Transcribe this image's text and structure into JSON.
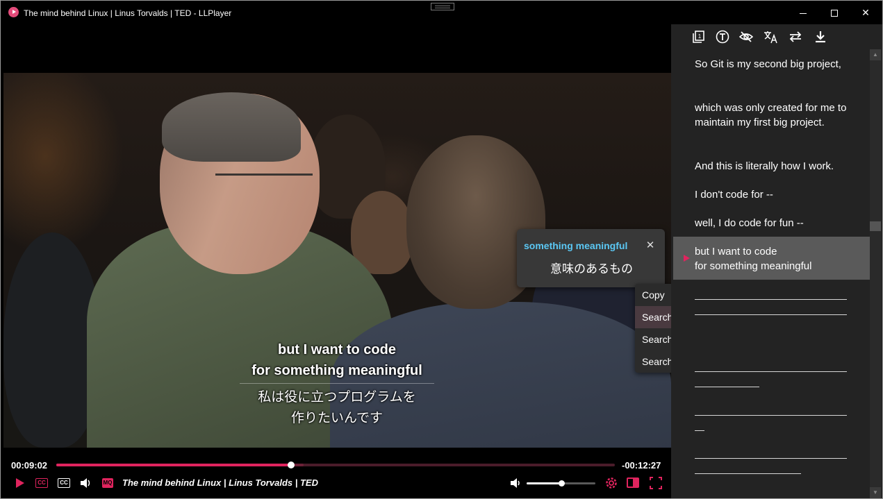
{
  "window": {
    "title": "The mind behind Linux | Linus Torvalds | TED - LLPlayer",
    "minimize_glyph": "─",
    "close_glyph": "✕"
  },
  "video": {
    "subtitle_primary": [
      "but I want to code",
      "for something meaningful"
    ],
    "subtitle_secondary": [
      "私は役に立つプログラムを",
      "作りたいんです"
    ]
  },
  "popup": {
    "word": "something meaningful",
    "translation": "意味のあるもの",
    "close_glyph": "✕"
  },
  "context_menu": {
    "items": [
      "Copy",
      "Search Google",
      "Search Wiktionary",
      "Search Longman"
    ],
    "highlighted": "Search Google"
  },
  "controls": {
    "current_time": "00:09:02",
    "remaining_time": "-00:12:27",
    "progress": 0.4204,
    "buffered": 0.443,
    "volume": 0.5,
    "cc_label": "CC",
    "mq_label": "MQ",
    "video_title": "The mind behind Linux | Linus Torvalds | TED",
    "colors": {
      "accent": "#e0245e"
    }
  },
  "panel": {
    "toolbar_icons": [
      "copy-icon",
      "text-icon",
      "hide-icon",
      "translate-icon",
      "swap-icon",
      "download-icon"
    ],
    "subtitles": [
      "So Git is my second big project,",
      "which was only created for me to maintain my first big project.",
      "And this is literally how I work.",
      "I don't code for --",
      "well, I do code for fun --",
      "but I want to code\nfor something meaningful"
    ],
    "active_index": 5
  }
}
